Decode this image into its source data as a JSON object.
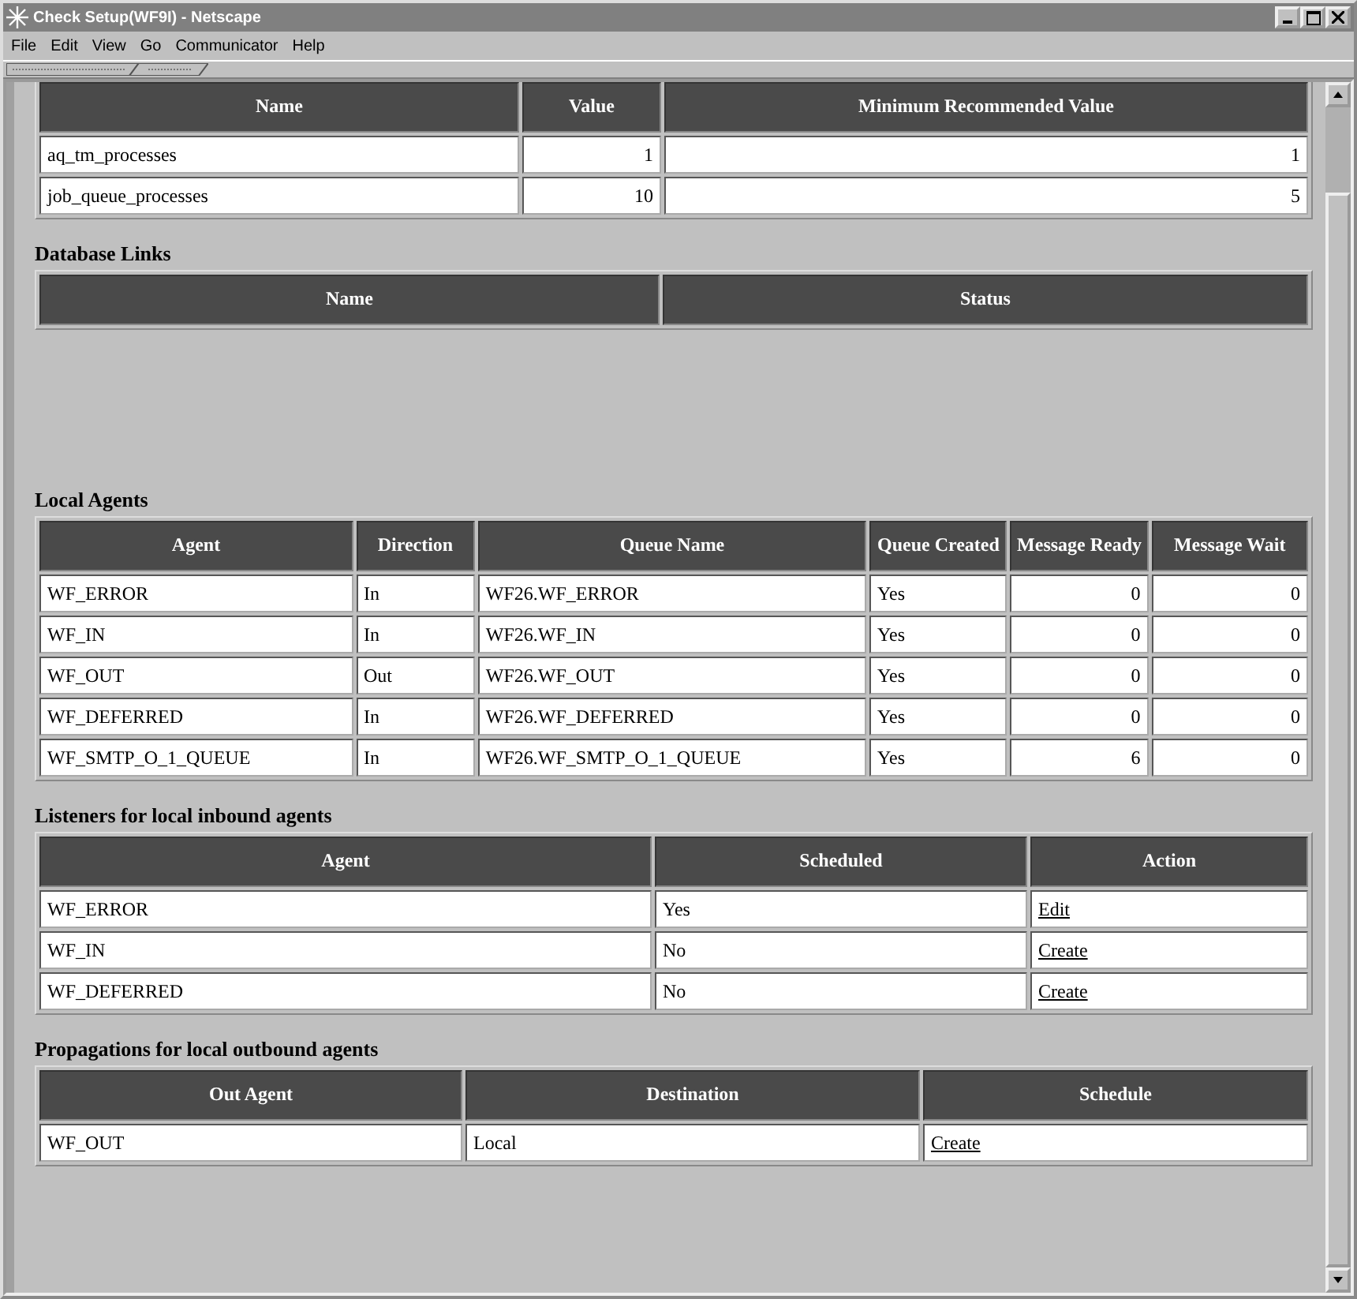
{
  "window": {
    "title": "Check Setup(WF9I) - Netscape"
  },
  "menu": [
    {
      "label": "File"
    },
    {
      "label": "Edit"
    },
    {
      "label": "View"
    },
    {
      "label": "Go"
    },
    {
      "label": "Communicator"
    },
    {
      "label": "Help"
    }
  ],
  "sections": [
    {
      "columns": [
        {
          "label": "Name",
          "kind": "text"
        },
        {
          "label": "Value",
          "kind": "number"
        },
        {
          "label": "Minimum Recommended Value",
          "kind": "number"
        }
      ],
      "rows": [
        [
          "aq_tm_processes",
          "1",
          "1"
        ],
        [
          "job_queue_processes",
          "10",
          "5"
        ]
      ]
    },
    {
      "heading": "Database Links",
      "columns": [
        {
          "label": "Name"
        },
        {
          "label": "Status"
        }
      ]
    },
    {
      "heading": "Local Agents",
      "columns": [
        {
          "label": "Agent",
          "kind": "text"
        },
        {
          "label": "Direction",
          "kind": "text"
        },
        {
          "label": "Queue Name",
          "kind": "text"
        },
        {
          "label": "Queue Created",
          "kind": "text"
        },
        {
          "label": "Message Ready",
          "kind": "number"
        },
        {
          "label": "Message Wait",
          "kind": "number"
        }
      ],
      "rows": [
        [
          "WF_ERROR",
          "In",
          "WF26.WF_ERROR",
          "Yes",
          "0",
          "0"
        ],
        [
          "WF_IN",
          "In",
          "WF26.WF_IN",
          "Yes",
          "0",
          "0"
        ],
        [
          "WF_OUT",
          "Out",
          "WF26.WF_OUT",
          "Yes",
          "0",
          "0"
        ],
        [
          "WF_DEFERRED",
          "In",
          "WF26.WF_DEFERRED",
          "Yes",
          "0",
          "0"
        ],
        [
          "WF_SMTP_O_1_QUEUE",
          "In",
          "WF26.WF_SMTP_O_1_QUEUE",
          "Yes",
          "6",
          "0"
        ]
      ]
    },
    {
      "heading": "Listeners for local inbound agents",
      "columns": [
        {
          "label": "Agent",
          "kind": "text"
        },
        {
          "label": "Scheduled",
          "kind": "text"
        },
        {
          "label": "Action",
          "kind": "link"
        }
      ],
      "rows": [
        [
          "WF_ERROR",
          "Yes",
          "Edit"
        ],
        [
          "WF_IN",
          "No",
          "Create"
        ],
        [
          "WF_DEFERRED",
          "No",
          "Create"
        ]
      ]
    },
    {
      "heading": "Propagations for local outbound agents",
      "columns": [
        {
          "label": "Out Agent",
          "kind": "text"
        },
        {
          "label": "Destination",
          "kind": "text"
        },
        {
          "label": "Schedule",
          "kind": "link"
        }
      ],
      "rows": [
        [
          "WF_OUT",
          "Local",
          "Create"
        ]
      ]
    }
  ]
}
